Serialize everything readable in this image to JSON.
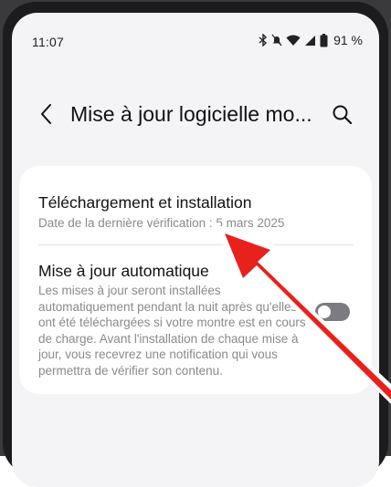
{
  "status_bar": {
    "time": "11:07",
    "battery": "91 %",
    "icons": [
      "bluetooth-icon",
      "silent-icon",
      "wifi-icon",
      "signal-icon",
      "battery-icon"
    ]
  },
  "header": {
    "title": "Mise à jour logicielle mo",
    "title_ellipsis": "...",
    "back_icon": "chevron-left-icon",
    "search_icon": "search-icon"
  },
  "settings": {
    "download": {
      "title": "Téléchargement et installation",
      "subtitle": "Date de la dernière vérification : 5 mars 2025"
    },
    "auto_update": {
      "title": "Mise à jour automatique",
      "description": "Les mises à jour seront installées automatiquement pendant la nuit après qu'elles ont été téléchargées si votre montre est en cours de charge. Avant l'installation de chaque mise à jour, vous recevrez une notification qui vous permettra de vérifier son contenu.",
      "enabled": false
    }
  },
  "colors": {
    "screen_background": "#f4f4f6",
    "card_background": "#ffffff",
    "secondary_text": "#8a8a8e",
    "toggle_off": "#7c7c80",
    "annotation_arrow": "#e8211c"
  }
}
